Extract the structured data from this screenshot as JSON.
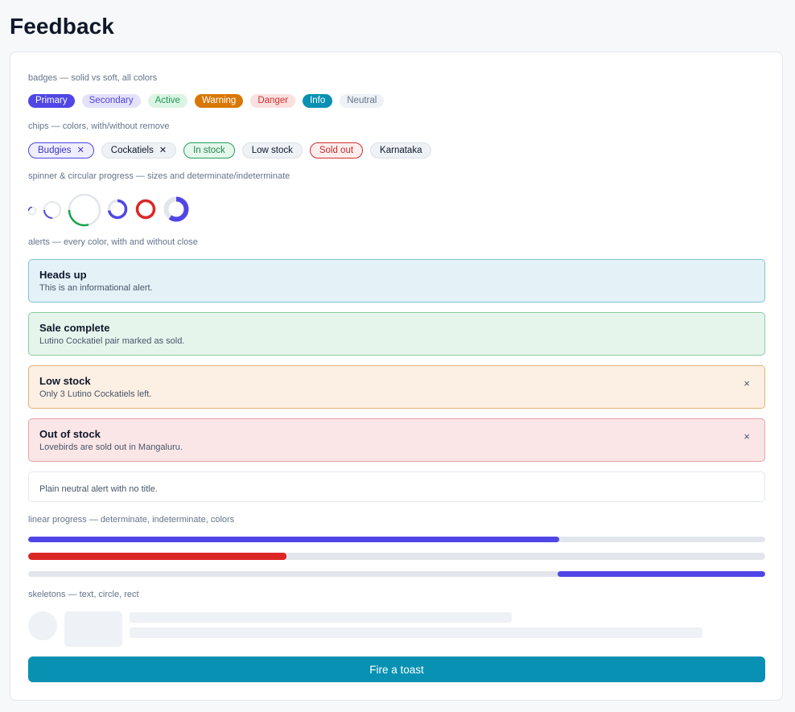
{
  "page": {
    "title": "Feedback"
  },
  "sections": {
    "badges": "badges — solid vs soft, all colors",
    "chips": "chips — colors, with/without remove",
    "spinners": "spinner & circular progress — sizes and determinate/indeterminate",
    "alerts": "alerts — every color, with and without close",
    "linear": "linear progress — determinate, indeterminate, colors",
    "skeletons": "skeletons — text, circle, rect"
  },
  "badges": [
    {
      "label": "Primary",
      "variant": "solid",
      "color": "#4f46e5"
    },
    {
      "label": "Secondary",
      "variant": "soft",
      "color": "#5145d8"
    },
    {
      "label": "Active",
      "variant": "soft",
      "color": "#1e9a53"
    },
    {
      "label": "Warning",
      "variant": "solid",
      "color": "#d97706"
    },
    {
      "label": "Danger",
      "variant": "soft",
      "color": "#d12f2f"
    },
    {
      "label": "Info",
      "variant": "solid",
      "color": "#0891b2"
    },
    {
      "label": "Neutral",
      "variant": "soft",
      "color": "#64748b"
    }
  ],
  "chips": [
    {
      "label": "Budgies",
      "removable": true,
      "remove_icon": "close-icon"
    },
    {
      "label": "Cockatiels",
      "removable": true,
      "remove_icon": "close-icon"
    },
    {
      "label": "In stock",
      "removable": false
    },
    {
      "label": "Low stock",
      "removable": false
    },
    {
      "label": "Sold out",
      "removable": false
    },
    {
      "label": "Karnataka",
      "removable": false
    }
  ],
  "spinners": [
    {
      "kind": "indeterminate",
      "color": "#4f46e5"
    },
    {
      "kind": "indeterminate",
      "color": "#4f46e5"
    },
    {
      "kind": "indeterminate",
      "color": "#16a34a"
    },
    {
      "kind": "determinate",
      "value": 0.72,
      "color": "#4f46e5"
    },
    {
      "kind": "determinate",
      "value": 1.0,
      "color": "#dc2626"
    },
    {
      "kind": "determinate",
      "value": 0.6,
      "color": "#4f46e5"
    }
  ],
  "alerts": [
    {
      "variant": "info",
      "title": "Heads up",
      "body": "This is an informational alert.",
      "closable": false
    },
    {
      "variant": "success",
      "title": "Sale complete",
      "body": "Lutino Cockatiel pair marked as sold.",
      "closable": false
    },
    {
      "variant": "warning",
      "title": "Low stock",
      "body": "Only 3 Lutino Cockatiels left.",
      "closable": true,
      "close_symbol": "×"
    },
    {
      "variant": "danger",
      "title": "Out of stock",
      "body": "Lovebirds are sold out in Mangaluru.",
      "closable": true,
      "close_symbol": "×"
    },
    {
      "variant": "neutral",
      "title": "",
      "body": "Plain neutral alert with no title.",
      "closable": false
    }
  ],
  "linear_progress": [
    {
      "kind": "determinate",
      "value": 0.72,
      "color": "#4f46e5"
    },
    {
      "kind": "determinate",
      "value": 0.35,
      "color": "#dc2626"
    },
    {
      "kind": "indeterminate",
      "color": "#4f46e5"
    }
  ],
  "skeleton_colors": {
    "fill": "#eef1f5"
  },
  "button": {
    "label": "Fire a toast",
    "color": "#0891b2"
  }
}
